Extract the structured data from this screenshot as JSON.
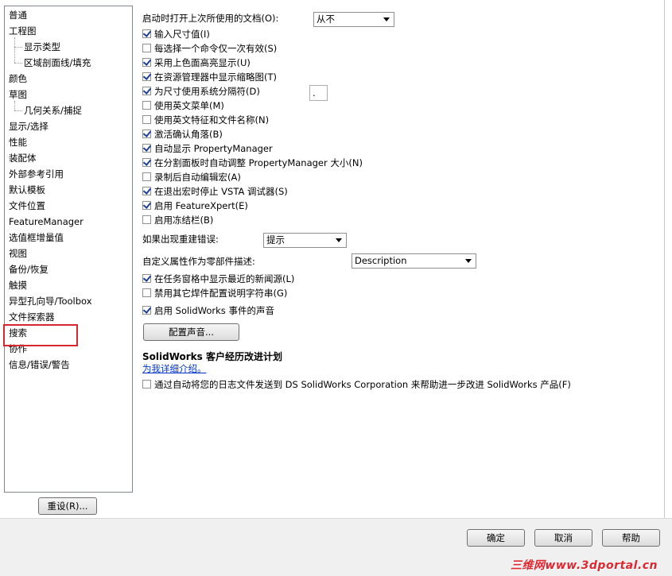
{
  "tree": {
    "items": [
      {
        "label": "普通",
        "level": 0
      },
      {
        "label": "工程图",
        "level": 0
      },
      {
        "label": "显示类型",
        "level": 1
      },
      {
        "label": "区域剖面线/填充",
        "level": 1
      },
      {
        "label": "颜色",
        "level": 0
      },
      {
        "label": "草图",
        "level": 0
      },
      {
        "label": "几何关系/捕捉",
        "level": 1
      },
      {
        "label": "显示/选择",
        "level": 0
      },
      {
        "label": "性能",
        "level": 0
      },
      {
        "label": "装配体",
        "level": 0
      },
      {
        "label": "外部参考引用",
        "level": 0
      },
      {
        "label": "默认模板",
        "level": 0
      },
      {
        "label": "文件位置",
        "level": 0
      },
      {
        "label": "FeatureManager",
        "level": 0
      },
      {
        "label": "选值框增量值",
        "level": 0
      },
      {
        "label": "视图",
        "level": 0
      },
      {
        "label": "备份/恢复",
        "level": 0
      },
      {
        "label": "触摸",
        "level": 0
      },
      {
        "label": "异型孔向导/Toolbox",
        "level": 0
      },
      {
        "label": "文件探索器",
        "level": 0
      },
      {
        "label": "搜索",
        "level": 0
      },
      {
        "label": "协作",
        "level": 0
      },
      {
        "label": "信息/错误/警告",
        "level": 0
      }
    ],
    "highlighted": "搜索",
    "highlight_color": "#d8262f"
  },
  "reset_button": "重设(R)...",
  "startup": {
    "label": "启动时打开上次所使用的文档(O):",
    "value": "从不"
  },
  "checks_a": [
    {
      "label": "输入尺寸值(I)",
      "checked": true
    },
    {
      "label": "每选择一个命令仅一次有效(S)",
      "checked": false
    },
    {
      "label": "采用上色面高亮显示(U)",
      "checked": true
    },
    {
      "label": "在资源管理器中显示缩略图(T)",
      "checked": true
    },
    {
      "label": "为尺寸使用系统分隔符(D)",
      "checked": true
    },
    {
      "label": "使用英文菜单(M)",
      "checked": false
    },
    {
      "label": "使用英文特征和文件名称(N)",
      "checked": false
    },
    {
      "label": "激活确认角落(B)",
      "checked": true
    },
    {
      "label": "自动显示 PropertyManager",
      "checked": true
    },
    {
      "label": "在分割面板时自动调整 PropertyManager 大小(N)",
      "checked": true
    },
    {
      "label": "录制后自动编辑宏(A)",
      "checked": false
    },
    {
      "label": "在退出宏时停止 VSTA 调试器(S)",
      "checked": true
    },
    {
      "label": "启用 FeatureXpert(E)",
      "checked": true
    },
    {
      "label": "启用冻结栏(B)",
      "checked": false
    }
  ],
  "separator_value": ".",
  "rebuild_error": {
    "label": "如果出现重建错误:",
    "value": "提示"
  },
  "custom_property": {
    "label": "自定义属性作为零部件描述:",
    "value": "Description"
  },
  "checks_b": [
    {
      "label": "在任务窗格中显示最近的新闻源(L)",
      "checked": true
    },
    {
      "label": "禁用其它焊件配置说明字符串(G)",
      "checked": false
    }
  ],
  "sound": {
    "label": "启用 SolidWorks 事件的声音",
    "checked": true,
    "button": "配置声音..."
  },
  "ceip": {
    "title": "SolidWorks 客户经历改进计划",
    "link": "为我详细介绍。",
    "check_label": "通过自动将您的日志文件发送到 DS SolidWorks Corporation 来帮助进一步改进 SolidWorks 产品(F)",
    "checked": false
  },
  "footer": {
    "ok": "确定",
    "cancel": "取消",
    "help": "帮助"
  },
  "watermark": "三维网www.3dportal.cn"
}
